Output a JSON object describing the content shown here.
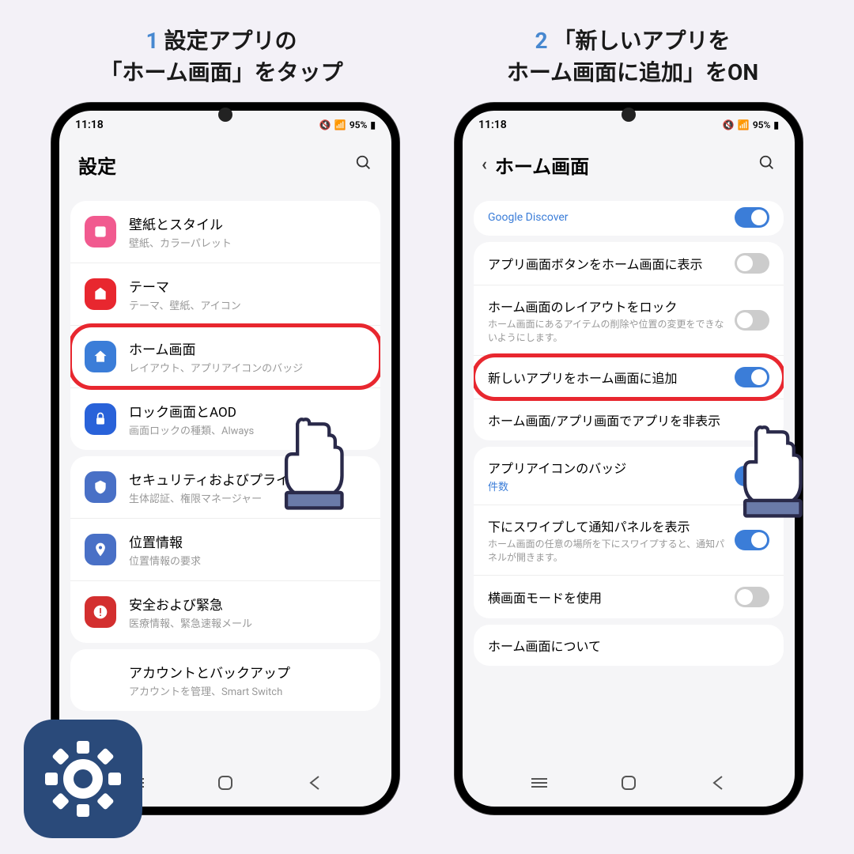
{
  "step1": {
    "num": "1",
    "line1": "設定アプリの",
    "line2": "「ホーム画面」をタップ"
  },
  "step2": {
    "num": "2",
    "line1": "「新しいアプリを",
    "line2": "ホーム画面に追加」をON"
  },
  "status": {
    "time": "11:18",
    "battery": "95%"
  },
  "screen1": {
    "title": "設定",
    "items": [
      {
        "title": "壁紙とスタイル",
        "sub": "壁紙、カラーパレット"
      },
      {
        "title": "テーマ",
        "sub": "テーマ、壁紙、アイコン"
      },
      {
        "title": "ホーム画面",
        "sub": "レイアウト、アプリアイコンのバッジ"
      },
      {
        "title": "ロック画面とAOD",
        "sub": "画面ロックの種類、Always"
      },
      {
        "title": "セキュリティおよびプライバシー",
        "sub": "生体認証、権限マネージャー"
      },
      {
        "title": "位置情報",
        "sub": "位置情報の要求"
      },
      {
        "title": "安全および緊急",
        "sub": "医療情報、緊急速報メール"
      },
      {
        "title": "アカウントとバックアップ",
        "sub": "アカウントを管理、Smart Switch"
      }
    ]
  },
  "screen2": {
    "title": "ホーム画面",
    "discover": "Google Discover",
    "items": [
      {
        "title": "アプリ画面ボタンをホーム画面に表示",
        "sub": "",
        "on": false
      },
      {
        "title": "ホーム画面のレイアウトをロック",
        "sub": "ホーム画面にあるアイテムの削除や位置の変更をできないようにします。",
        "on": false
      },
      {
        "title": "新しいアプリをホーム画面に追加",
        "sub": "",
        "on": true,
        "hl": true
      },
      {
        "title": "ホーム画面/アプリ画面でアプリを非表示",
        "sub": ""
      },
      {
        "title": "アプリアイコンのバッジ",
        "sub": "件数",
        "subBlue": true,
        "on": true
      },
      {
        "title": "下にスワイプして通知パネルを表示",
        "sub": "ホーム画面の任意の場所を下にスワイプすると、通知パネルが開きます。",
        "on": true
      },
      {
        "title": "横画面モードを使用",
        "sub": "",
        "on": false
      },
      {
        "title": "ホーム画面について",
        "sub": ""
      }
    ]
  }
}
